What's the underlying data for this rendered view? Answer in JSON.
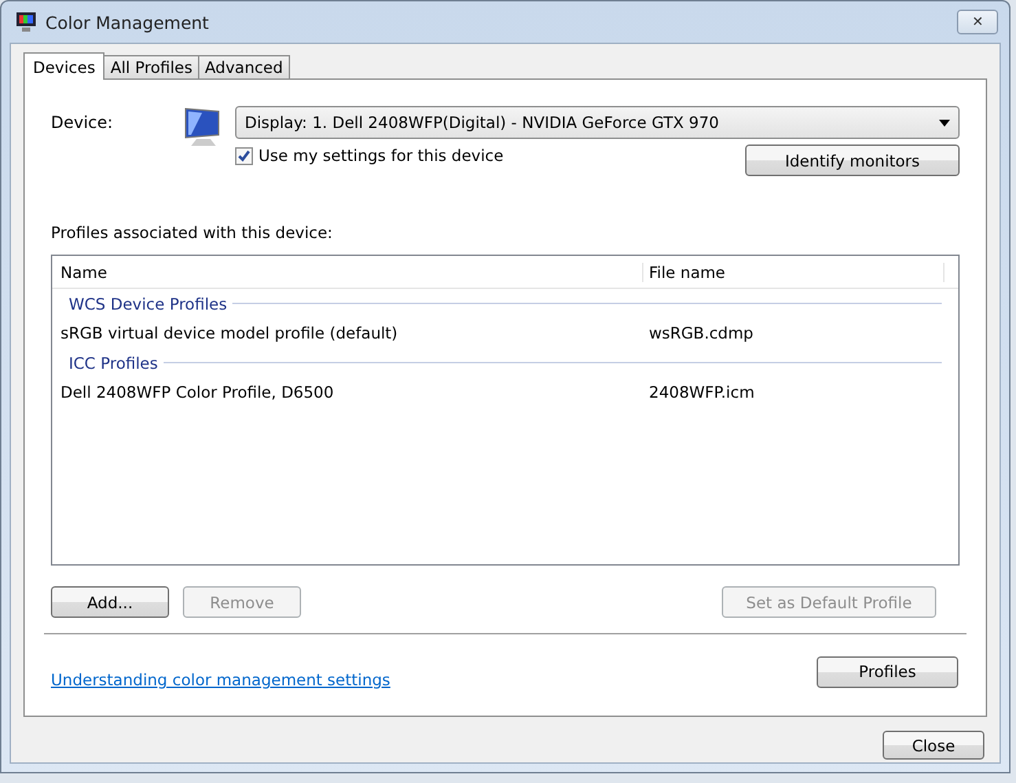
{
  "window": {
    "title": "Color Management",
    "close": "✕"
  },
  "tabs": [
    {
      "label": "Devices",
      "selected": true
    },
    {
      "label": "All Profiles",
      "selected": false
    },
    {
      "label": "Advanced",
      "selected": false
    }
  ],
  "device": {
    "label": "Device:",
    "value": "Display: 1. Dell 2408WFP(Digital) - NVIDIA GeForce GTX 970",
    "use_my_settings": {
      "label": "Use my settings for this device",
      "checked": true
    },
    "identify": "Identify monitors"
  },
  "profiles_label": "Profiles associated with this device:",
  "table": {
    "columns": [
      "Name",
      "File name"
    ],
    "rows": [
      {
        "kind": "group",
        "label": "WCS Device Profiles"
      },
      {
        "kind": "row",
        "name": "sRGB virtual device model profile (default)",
        "file": "wsRGB.cdmp"
      },
      {
        "kind": "group",
        "label": "ICC Profiles"
      },
      {
        "kind": "row",
        "name": "Dell 2408WFP Color Profile, D6500",
        "file": "2408WFP.icm"
      }
    ]
  },
  "actions": [
    {
      "label": "Add...",
      "disabled": false
    },
    {
      "label": "Remove",
      "disabled": true
    },
    {
      "label": "Set as Default Profile",
      "disabled": true
    }
  ],
  "link": "Understanding color management settings",
  "profiles_button": "Profiles",
  "close_button": "Close"
}
